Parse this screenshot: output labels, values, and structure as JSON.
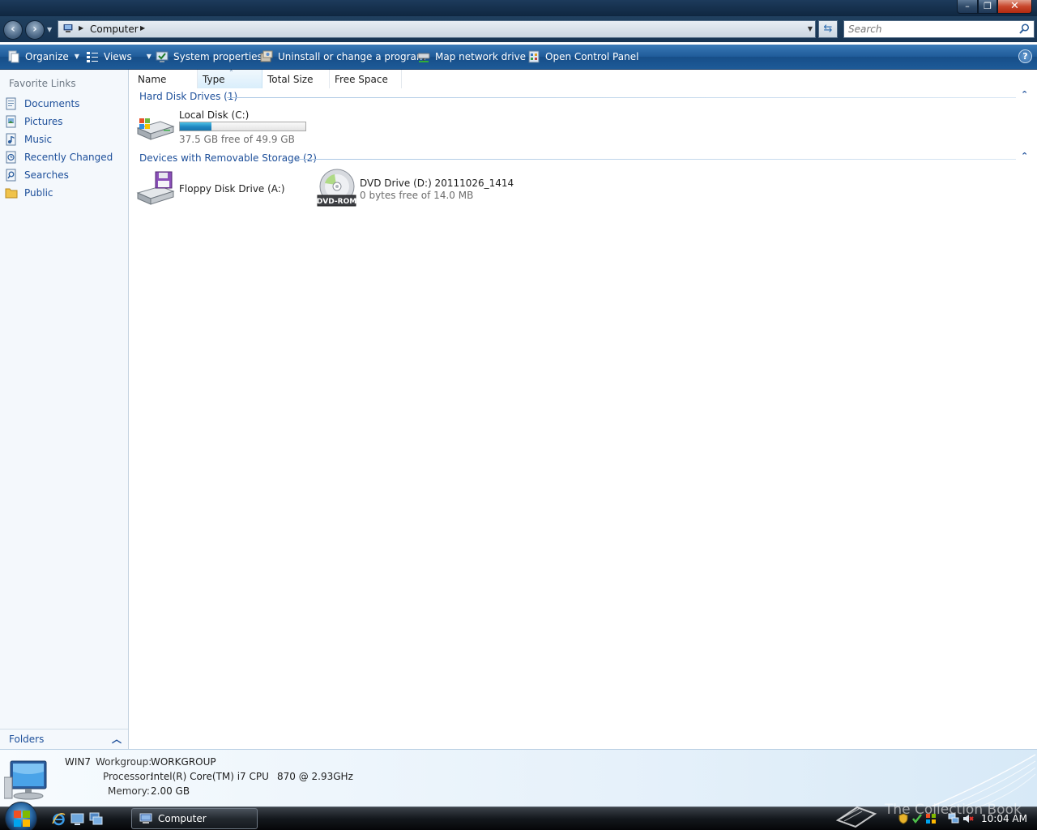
{
  "address": {
    "location": "Computer",
    "search_placeholder": "Search"
  },
  "toolbar": {
    "organize": "Organize",
    "views": "Views",
    "system_properties": "System properties",
    "uninstall": "Uninstall or change a program",
    "map_drive": "Map network drive",
    "control_panel": "Open Control Panel",
    "help": "?"
  },
  "nav": {
    "favorites_header": "Favorite Links",
    "items": [
      {
        "label": "Documents",
        "icon": "documents-icon"
      },
      {
        "label": "Pictures",
        "icon": "pictures-icon"
      },
      {
        "label": "Music",
        "icon": "music-icon"
      },
      {
        "label": "Recently Changed",
        "icon": "recently-changed-icon"
      },
      {
        "label": "Searches",
        "icon": "searches-icon"
      },
      {
        "label": "Public",
        "icon": "folder-icon"
      }
    ],
    "folders": "Folders"
  },
  "columns": [
    "Name",
    "Type",
    "Total Size",
    "Free Space"
  ],
  "groups": [
    {
      "label": "Hard Disk Drives (1)",
      "items": [
        {
          "name": "Local Disk (C:)",
          "detail": "37.5 GB free of 49.9 GB",
          "used_fraction": 0.25,
          "icon": "hard-disk-icon"
        }
      ]
    },
    {
      "label": "Devices with Removable Storage (2)",
      "items": [
        {
          "name": "Floppy Disk Drive (A:)",
          "icon": "floppy-drive-icon"
        },
        {
          "name": "DVD Drive (D:) 20111026_1414",
          "detail": "0 bytes free of 14.0 MB",
          "icon": "dvd-drive-icon",
          "badge": "DVD-ROM"
        }
      ]
    }
  ],
  "details": {
    "computer_name": "WIN7",
    "workgroup_label": "Workgroup:",
    "workgroup": "WORKGROUP",
    "processor_label": "Processor:",
    "processor": "Intel(R) Core(TM) i7 CPU",
    "processor_speed": "870  @ 2.93GHz",
    "memory_label": "Memory:",
    "memory": "2.00 GB"
  },
  "taskbar": {
    "task_label": "Computer",
    "clock": "10:04 AM",
    "watermark": "The Collection Book"
  },
  "colors": {
    "link_blue": "#1d4f9a",
    "toolbar_blue": "#1f5b99",
    "disk_fill": "#1e86c0"
  }
}
